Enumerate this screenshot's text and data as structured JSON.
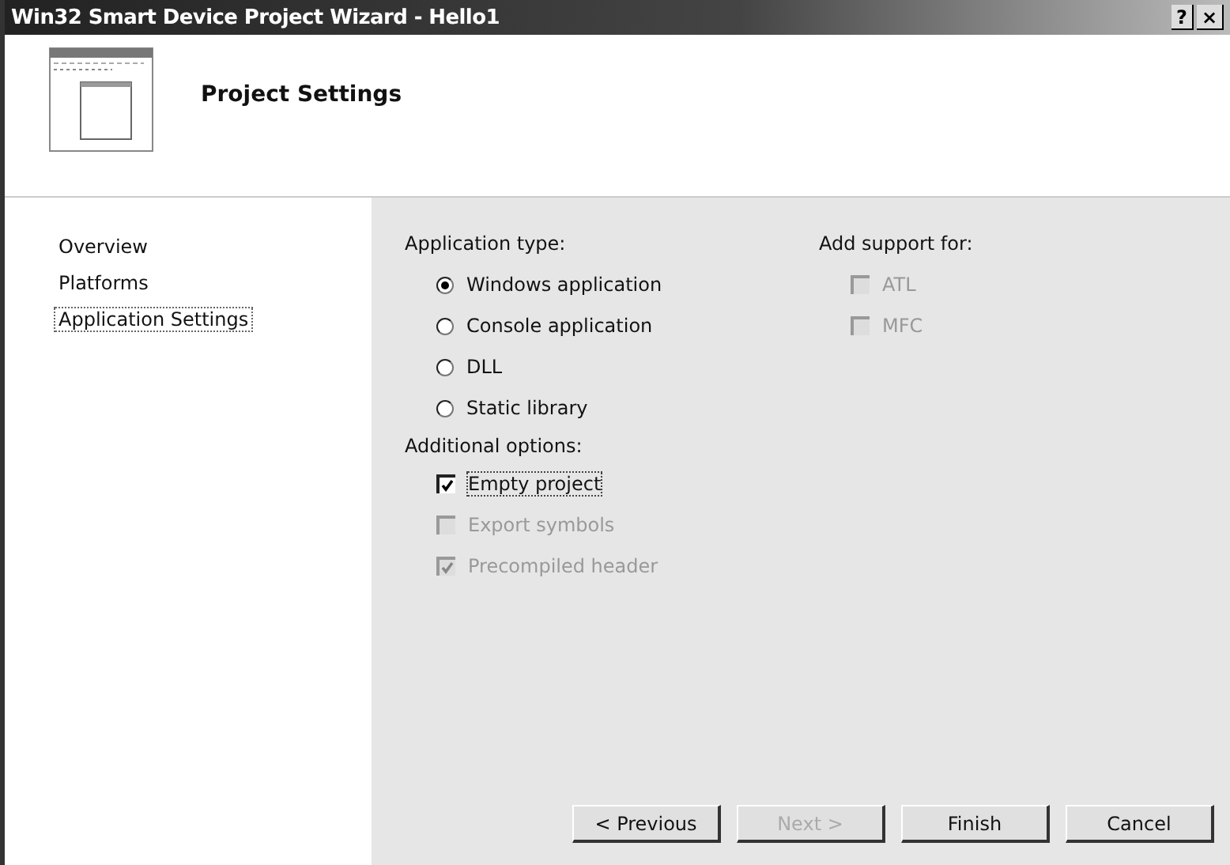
{
  "window": {
    "title": "Win32 Smart Device Project Wizard - Hello1",
    "help_button": "?",
    "close_button": "×"
  },
  "header": {
    "title": "Project Settings"
  },
  "sidebar": {
    "items": [
      {
        "label": "Overview",
        "selected": false
      },
      {
        "label": "Platforms",
        "selected": false
      },
      {
        "label": "Application Settings",
        "selected": true
      }
    ]
  },
  "application_type": {
    "label": "Application type:",
    "options": [
      {
        "label": "Windows application",
        "selected": true
      },
      {
        "label": "Console application",
        "selected": false
      },
      {
        "label": "DLL",
        "selected": false
      },
      {
        "label": "Static library",
        "selected": false
      }
    ]
  },
  "additional_options": {
    "label": "Additional options:",
    "options": [
      {
        "label": "Empty project",
        "checked": true,
        "disabled": false
      },
      {
        "label": "Export symbols",
        "checked": false,
        "disabled": true
      },
      {
        "label": "Precompiled header",
        "checked": true,
        "disabled": true
      }
    ]
  },
  "add_support": {
    "label": "Add support for:",
    "options": [
      {
        "label": "ATL",
        "checked": false,
        "disabled": true
      },
      {
        "label": "MFC",
        "checked": false,
        "disabled": true
      }
    ]
  },
  "buttons": [
    {
      "label": "< Previous",
      "disabled": false
    },
    {
      "label": "Next >",
      "disabled": true
    },
    {
      "label": "Finish",
      "disabled": false
    },
    {
      "label": "Cancel",
      "disabled": false
    }
  ]
}
